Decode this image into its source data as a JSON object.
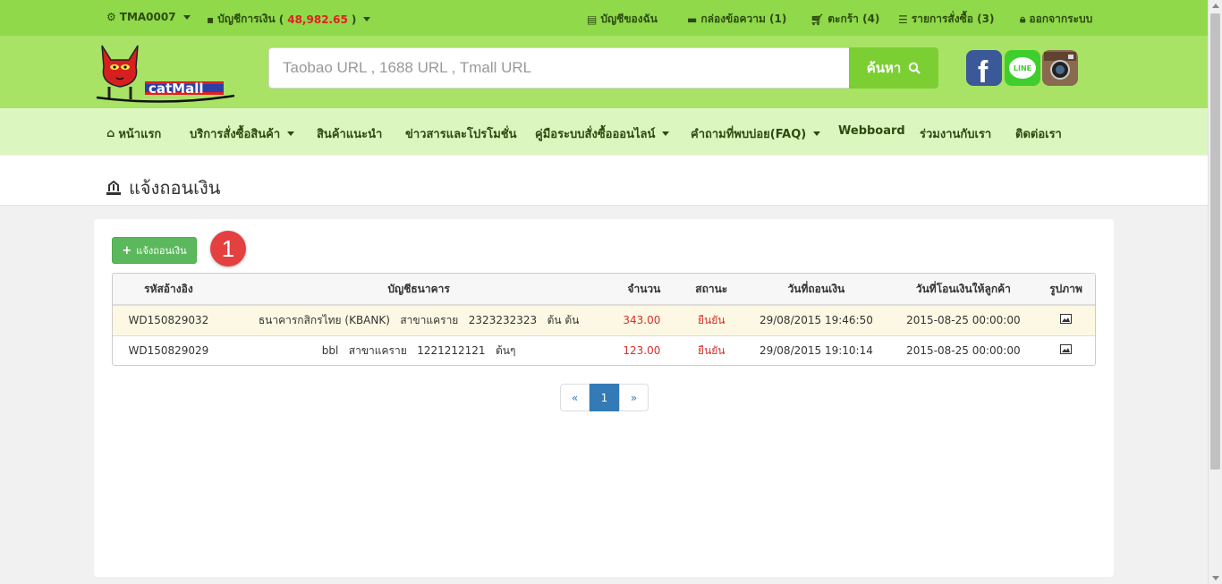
{
  "topbar": {
    "user": "TMA0007",
    "wallet_label": "บัญชีการเงิน",
    "wallet_open": "(",
    "wallet_amount": "48,982.65",
    "wallet_close": ")",
    "my_account": "บัญชีของฉัน",
    "messages": "กล่องข้อความ (1)",
    "cart": "ตะกร้า (4)",
    "orders": "รายการสั่งซื้อ (3)",
    "logout": "ออกจากระบบ"
  },
  "header": {
    "logo_text": "catMall",
    "search_placeholder": "Taobao URL , 1688 URL , Tmall URL",
    "search_button": "ค้นหา",
    "line_label": "LINE"
  },
  "nav": {
    "home": "หน้าแรก",
    "services": "บริการสั่งซื้อสินค้า",
    "recommended": "สินค้าแนะนำ",
    "news": "ข่าวสารและโปรโมชั่น",
    "manual": "คู่มือระบบสั่งซื้อออนไลน์",
    "faq": "คำถามที่พบบ่อย(FAQ)",
    "webboard": "Webboard",
    "partner": "ร่วมงานกับเรา",
    "contact": "ติดต่อเรา"
  },
  "page": {
    "title": "แจ้งถอนเงิน",
    "add_button": "แจ้งถอนเงิน",
    "badge": "1"
  },
  "table": {
    "headers": [
      "รหัสอ้างอิง",
      "บัญชีธนาคาร",
      "จำนวน",
      "สถานะ",
      "วันที่ถอนเงิน",
      "วันที่โอนเงินให้ลูกค้า",
      "รูปภาพ"
    ],
    "rows": [
      {
        "ref": "WD150829032",
        "bank": "ธนาคารกสิกรไทย (KBANK)   สาขาแคราย   2323232323   ต้น ต้น",
        "amount": "343.00",
        "status": "ยืนยัน",
        "withdraw_date": "29/08/2015 19:46:50",
        "transfer_date": "2015-08-25 00:00:00"
      },
      {
        "ref": "WD150829029",
        "bank": "bbl   สาขาแคราย   1221212121   ต้นๆ",
        "amount": "123.00",
        "status": "ยืนยัน",
        "withdraw_date": "29/08/2015 19:10:14",
        "transfer_date": "2015-08-25 00:00:00"
      }
    ]
  },
  "pagination": {
    "prev": "«",
    "current": "1",
    "next": "»"
  },
  "colors": {
    "topbar": "#8fd94a",
    "header": "#a8e365",
    "nav": "#dcf6c0",
    "accent_green": "#5cb85c",
    "red": "#d9302c",
    "link_blue": "#337ab7"
  }
}
